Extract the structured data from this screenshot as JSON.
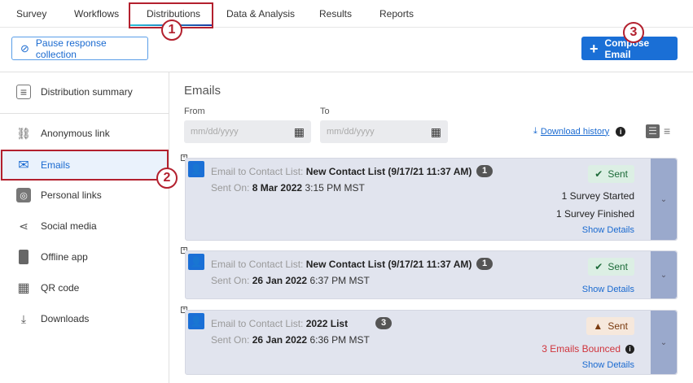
{
  "tabs": [
    "Survey",
    "Workflows",
    "Distributions",
    "Data & Analysis",
    "Results",
    "Reports"
  ],
  "annotations": [
    "1",
    "2",
    "3"
  ],
  "toolbar": {
    "pause_label": "Pause response collection",
    "compose_label": "Compose Email"
  },
  "sidebar": {
    "items": [
      {
        "label": "Distribution summary"
      },
      {
        "label": "Anonymous link"
      },
      {
        "label": "Emails"
      },
      {
        "label": "Personal links"
      },
      {
        "label": "Social media"
      },
      {
        "label": "Offline app"
      },
      {
        "label": "QR code"
      },
      {
        "label": "Downloads"
      }
    ]
  },
  "main": {
    "title": "Emails",
    "from_label": "From",
    "to_label": "To",
    "from_placeholder": "mm/dd/yyyy",
    "to_placeholder": "mm/dd/yyyy",
    "download_history": "Download history"
  },
  "emails": [
    {
      "prefix": "Email to Contact List:",
      "list": "New Contact List (9/17/21 11:37 AM)",
      "count": "1",
      "sent_prefix": "Sent On:",
      "date": "8 Mar 2022",
      "time": "3:15 PM MST",
      "status": "Sent",
      "stats": [
        "1 Survey Started",
        "1 Survey Finished"
      ],
      "details": "Show Details"
    },
    {
      "prefix": "Email to Contact List:",
      "list": "New Contact List (9/17/21 11:37 AM)",
      "count": "1",
      "sent_prefix": "Sent On:",
      "date": "26 Jan 2022",
      "time": "6:37 PM MST",
      "status": "Sent",
      "details": "Show Details"
    },
    {
      "prefix": "Email to Contact List:",
      "list": "2022 List",
      "count": "3",
      "sent_prefix": "Sent On:",
      "date": "26 Jan 2022",
      "time": "6:36 PM MST",
      "status": "Sent",
      "bounced": "3 Emails Bounced",
      "details": "Show Details"
    }
  ],
  "colors": {
    "accent": "#1a6fd6",
    "annotation": "#b3202e",
    "bounced": "#d0343c"
  }
}
